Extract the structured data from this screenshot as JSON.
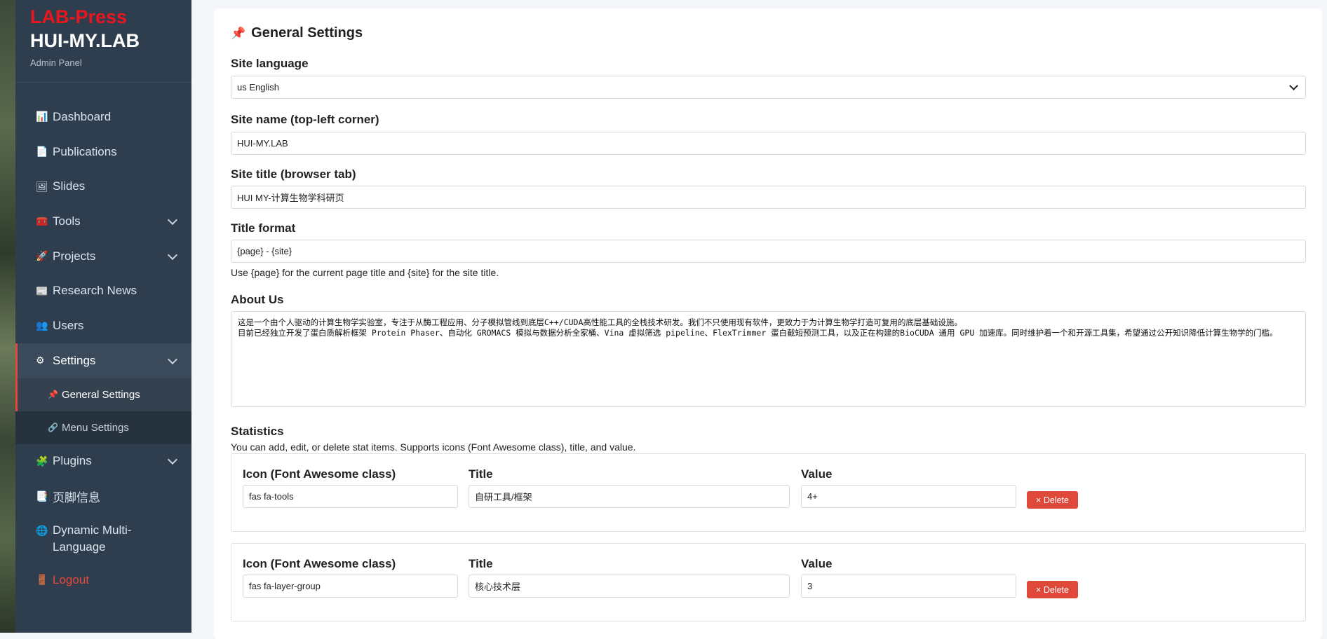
{
  "sidebar": {
    "brand_top": "LAB-Press",
    "brand_main": "HUI-MY.LAB",
    "brand_sub": "Admin Panel",
    "items": [
      {
        "label": "Dashboard",
        "icon": "chart-icon",
        "glyph": "📊"
      },
      {
        "label": "Publications",
        "icon": "document-icon",
        "glyph": "📄"
      },
      {
        "label": "Slides",
        "icon": "image-icon",
        "glyph": "🖼"
      },
      {
        "label": "Tools",
        "icon": "toolbox-icon",
        "glyph": "🧰"
      },
      {
        "label": "Projects",
        "icon": "rocket-icon",
        "glyph": "🚀"
      },
      {
        "label": "Research News",
        "icon": "newspaper-icon",
        "glyph": "📰"
      },
      {
        "label": "Users",
        "icon": "users-icon",
        "glyph": "👥"
      },
      {
        "label": "Settings",
        "icon": "gear-icon",
        "glyph": "⚙"
      },
      {
        "label": "Plugins",
        "icon": "puzzle-icon",
        "glyph": "🧩"
      },
      {
        "label": "页脚信息",
        "icon": "bookmark-icon",
        "glyph": "📑"
      },
      {
        "label": "Dynamic Multi-Language",
        "icon": "globe-icon",
        "glyph": "🌐"
      },
      {
        "label": "Logout",
        "icon": "door-icon",
        "glyph": "🚪"
      }
    ],
    "settings_sub": [
      {
        "label": "General Settings",
        "icon": "pin-icon",
        "glyph": "📌"
      },
      {
        "label": "Menu Settings",
        "icon": "link-icon",
        "glyph": "🔗"
      }
    ]
  },
  "main": {
    "heading": "General Settings",
    "heading_glyph": "📌",
    "site_language_label": "Site language",
    "site_language_value": "us English",
    "site_name_label": "Site name (top-left corner)",
    "site_name_value": "HUI-MY.LAB",
    "site_title_label": "Site title (browser tab)",
    "site_title_value": "HUI MY-计算生物学科研页",
    "title_format_label": "Title format",
    "title_format_value": "{page} - {site}",
    "title_format_help": "Use {page} for the current page title and {site} for the site title.",
    "about_label": "About Us",
    "about_value": "这是一个由个人驱动的计算生物学实验室，专注于从酶工程应用、分子模拟管线到底层C++/CUDA高性能工具的全栈技术研发。我们不只使用现有软件，更致力于为计算生物学打造可复用的底层基础设施。\n目前已经独立开发了蛋白质解析框架 Protein Phaser、自动化 GROMACS 模拟与数据分析全家桶、Vina 虚拟筛选 pipeline、FlexTrimmer 蛋白截短预测工具，以及正在构建的BioCUDA 通用 GPU 加速库。同时维护着一个和开源工具集，希望通过公开知识降低计算生物学的门槛。",
    "stats_label": "Statistics",
    "stats_help": "You can add, edit, or delete stat items. Supports icons (Font Awesome class), title, and value.",
    "stat_icon_label": "Icon (Font Awesome class)",
    "stat_title_label": "Title",
    "stat_value_label": "Value",
    "delete_label": "× Delete",
    "stats": [
      {
        "icon": "fas fa-tools",
        "title": "自研工具/框架",
        "value": "4+"
      },
      {
        "icon": "fas fa-layer-group",
        "title": "核心技术层",
        "value": "3"
      }
    ]
  }
}
